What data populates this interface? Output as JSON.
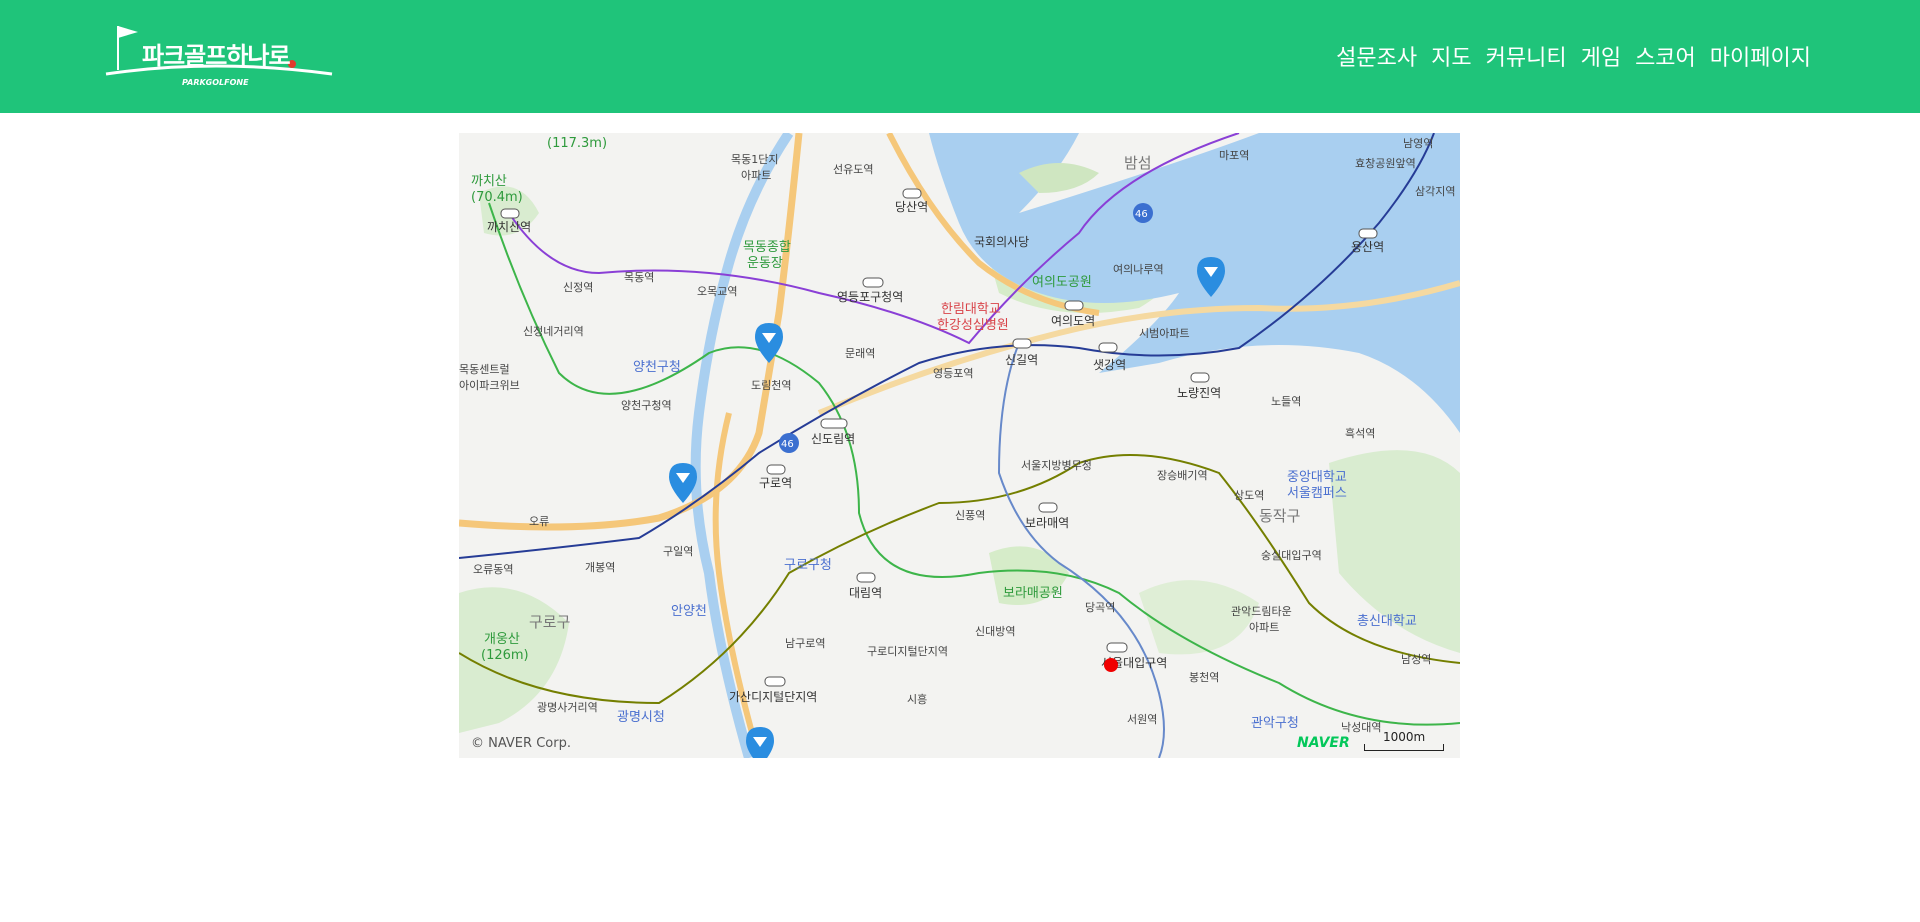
{
  "brand": {
    "name": "파크골프하나로",
    "subtitle": "PARKGOLFONE"
  },
  "nav": {
    "items": [
      "설문조사",
      "지도",
      "커뮤니티",
      "게임",
      "스코어",
      "마이페이지"
    ]
  },
  "map": {
    "copyright": "© NAVER Corp.",
    "provider": "NAVER",
    "scale": "1000m",
    "labels": {
      "river": "밤섬",
      "route_46": "46",
      "park_yeouido": "여의도공원",
      "park_boramae": "보라매공원",
      "mountain_kkachi": "까치산",
      "mountain_kkachi_height": "(70.4m)",
      "mountain_top_height": "(117.3m)",
      "mountain_gaeung": "개웅산",
      "mountain_gaeung_height": "(126m)",
      "district_guro": "구로구",
      "district_dongjak": "동작구",
      "stream_anyang": "안양천",
      "apt_mokdong": "목동1단지",
      "apt_mokdong2": "아파트",
      "stadium": "목동종합",
      "stadium2": "운동장",
      "national_assembly": "국회의사당",
      "hospital": "한림대학교",
      "hospital2": "한강성심병원",
      "cityapt": "시범아파트",
      "yangcheon_office": "양천구청",
      "guro_office": "구로구청",
      "gwangmyeong_office": "광명시청",
      "mokdong_central": "목동센트럴",
      "mokdong_central2": "아이파크위브",
      "cau": "중앙대학교",
      "cau2": "서울캠퍼스",
      "gwanak_apt": "관악드림타운",
      "gwanak_apt2": "아파트",
      "gwanak_office": "관악구청",
      "chongshin": "총신대학교",
      "military": "서울지방병무청",
      "gasan": "가산디지털단지역",
      "ic_oryu": "오류",
      "ic_siheung": "시흥",
      "stations": [
        "까치산역",
        "신정역",
        "목동역",
        "오목교역",
        "영등포구청역",
        "당산역",
        "선유도역",
        "여의나루역",
        "여의도역",
        "신길역",
        "샛강역",
        "노량진역",
        "노들역",
        "흑석역",
        "문래역",
        "영등포역",
        "도림천역",
        "신도림역",
        "구로역",
        "구일역",
        "개봉역",
        "오류동역",
        "신정네거리역",
        "양천구청역",
        "대림역",
        "신풍역",
        "보라매역",
        "장승배기역",
        "상도역",
        "숭실대입구역",
        "당곡역",
        "신대방역",
        "구로디지털단지역",
        "남구로역",
        "봉천역",
        "서원역",
        "낙성대역",
        "광명사거리역",
        "효창공원앞역",
        "용산역",
        "남영역",
        "삼각지역",
        "마포역",
        "남성역",
        "서울대입구역"
      ]
    }
  }
}
